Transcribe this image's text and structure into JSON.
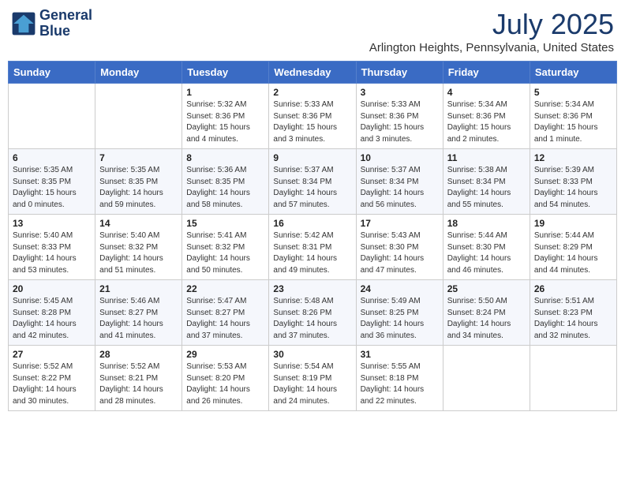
{
  "header": {
    "logo_line1": "General",
    "logo_line2": "Blue",
    "month_title": "July 2025",
    "location": "Arlington Heights, Pennsylvania, United States"
  },
  "weekdays": [
    "Sunday",
    "Monday",
    "Tuesday",
    "Wednesday",
    "Thursday",
    "Friday",
    "Saturday"
  ],
  "weeks": [
    [
      {
        "day": "",
        "text": ""
      },
      {
        "day": "",
        "text": ""
      },
      {
        "day": "1",
        "text": "Sunrise: 5:32 AM\nSunset: 8:36 PM\nDaylight: 15 hours\nand 4 minutes."
      },
      {
        "day": "2",
        "text": "Sunrise: 5:33 AM\nSunset: 8:36 PM\nDaylight: 15 hours\nand 3 minutes."
      },
      {
        "day": "3",
        "text": "Sunrise: 5:33 AM\nSunset: 8:36 PM\nDaylight: 15 hours\nand 3 minutes."
      },
      {
        "day": "4",
        "text": "Sunrise: 5:34 AM\nSunset: 8:36 PM\nDaylight: 15 hours\nand 2 minutes."
      },
      {
        "day": "5",
        "text": "Sunrise: 5:34 AM\nSunset: 8:36 PM\nDaylight: 15 hours\nand 1 minute."
      }
    ],
    [
      {
        "day": "6",
        "text": "Sunrise: 5:35 AM\nSunset: 8:35 PM\nDaylight: 15 hours\nand 0 minutes."
      },
      {
        "day": "7",
        "text": "Sunrise: 5:35 AM\nSunset: 8:35 PM\nDaylight: 14 hours\nand 59 minutes."
      },
      {
        "day": "8",
        "text": "Sunrise: 5:36 AM\nSunset: 8:35 PM\nDaylight: 14 hours\nand 58 minutes."
      },
      {
        "day": "9",
        "text": "Sunrise: 5:37 AM\nSunset: 8:34 PM\nDaylight: 14 hours\nand 57 minutes."
      },
      {
        "day": "10",
        "text": "Sunrise: 5:37 AM\nSunset: 8:34 PM\nDaylight: 14 hours\nand 56 minutes."
      },
      {
        "day": "11",
        "text": "Sunrise: 5:38 AM\nSunset: 8:34 PM\nDaylight: 14 hours\nand 55 minutes."
      },
      {
        "day": "12",
        "text": "Sunrise: 5:39 AM\nSunset: 8:33 PM\nDaylight: 14 hours\nand 54 minutes."
      }
    ],
    [
      {
        "day": "13",
        "text": "Sunrise: 5:40 AM\nSunset: 8:33 PM\nDaylight: 14 hours\nand 53 minutes."
      },
      {
        "day": "14",
        "text": "Sunrise: 5:40 AM\nSunset: 8:32 PM\nDaylight: 14 hours\nand 51 minutes."
      },
      {
        "day": "15",
        "text": "Sunrise: 5:41 AM\nSunset: 8:32 PM\nDaylight: 14 hours\nand 50 minutes."
      },
      {
        "day": "16",
        "text": "Sunrise: 5:42 AM\nSunset: 8:31 PM\nDaylight: 14 hours\nand 49 minutes."
      },
      {
        "day": "17",
        "text": "Sunrise: 5:43 AM\nSunset: 8:30 PM\nDaylight: 14 hours\nand 47 minutes."
      },
      {
        "day": "18",
        "text": "Sunrise: 5:44 AM\nSunset: 8:30 PM\nDaylight: 14 hours\nand 46 minutes."
      },
      {
        "day": "19",
        "text": "Sunrise: 5:44 AM\nSunset: 8:29 PM\nDaylight: 14 hours\nand 44 minutes."
      }
    ],
    [
      {
        "day": "20",
        "text": "Sunrise: 5:45 AM\nSunset: 8:28 PM\nDaylight: 14 hours\nand 42 minutes."
      },
      {
        "day": "21",
        "text": "Sunrise: 5:46 AM\nSunset: 8:27 PM\nDaylight: 14 hours\nand 41 minutes."
      },
      {
        "day": "22",
        "text": "Sunrise: 5:47 AM\nSunset: 8:27 PM\nDaylight: 14 hours\nand 37 minutes."
      },
      {
        "day": "23",
        "text": "Sunrise: 5:48 AM\nSunset: 8:26 PM\nDaylight: 14 hours\nand 37 minutes."
      },
      {
        "day": "24",
        "text": "Sunrise: 5:49 AM\nSunset: 8:25 PM\nDaylight: 14 hours\nand 36 minutes."
      },
      {
        "day": "25",
        "text": "Sunrise: 5:50 AM\nSunset: 8:24 PM\nDaylight: 14 hours\nand 34 minutes."
      },
      {
        "day": "26",
        "text": "Sunrise: 5:51 AM\nSunset: 8:23 PM\nDaylight: 14 hours\nand 32 minutes."
      }
    ],
    [
      {
        "day": "27",
        "text": "Sunrise: 5:52 AM\nSunset: 8:22 PM\nDaylight: 14 hours\nand 30 minutes."
      },
      {
        "day": "28",
        "text": "Sunrise: 5:52 AM\nSunset: 8:21 PM\nDaylight: 14 hours\nand 28 minutes."
      },
      {
        "day": "29",
        "text": "Sunrise: 5:53 AM\nSunset: 8:20 PM\nDaylight: 14 hours\nand 26 minutes."
      },
      {
        "day": "30",
        "text": "Sunrise: 5:54 AM\nSunset: 8:19 PM\nDaylight: 14 hours\nand 24 minutes."
      },
      {
        "day": "31",
        "text": "Sunrise: 5:55 AM\nSunset: 8:18 PM\nDaylight: 14 hours\nand 22 minutes."
      },
      {
        "day": "",
        "text": ""
      },
      {
        "day": "",
        "text": ""
      }
    ]
  ]
}
